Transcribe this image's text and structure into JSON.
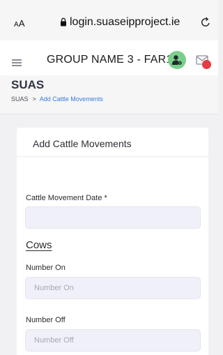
{
  "browser": {
    "text_size_label": "AA",
    "url": "login.suaseipproject.ie"
  },
  "header": {
    "group_name": "GROUP NAME 3 -  FAR1"
  },
  "page": {
    "title": "SUAS",
    "breadcrumb": [
      "SUAS",
      "Add Cattle Movements"
    ]
  },
  "form": {
    "card_title": "Add Cattle Movements",
    "date_label": "Cattle Movement Date *",
    "date_value": "",
    "section_title": "Cows",
    "number_on_label": "Number On",
    "number_on_placeholder": "Number On",
    "number_off_label": "Number Off",
    "number_off_placeholder": "Number Off"
  },
  "colors": {
    "accent": "#3a7bd5",
    "user_icon_bg": "#7ad08a",
    "notification_badge": "#e53b44",
    "input_bg": "#f0f1f8"
  }
}
